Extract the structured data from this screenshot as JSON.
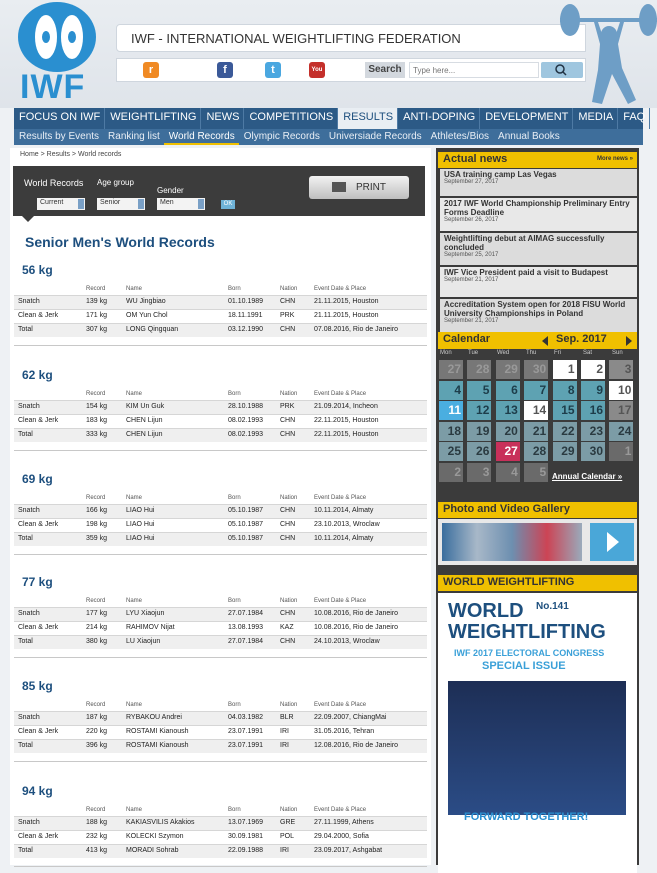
{
  "site": {
    "logo": "IWF",
    "title": "IWF  -  INTERNATIONAL WEIGHTLIFTING FEDERATION",
    "search_label": "Search",
    "search_placeholder": "Type here..."
  },
  "nav": [
    "FOCUS ON IWF",
    "WEIGHTLIFTING",
    "NEWS",
    "COMPETITIONS",
    "RESULTS",
    "ANTI-DOPING",
    "DEVELOPMENT",
    "MEDIA",
    "FAQ"
  ],
  "subnav": [
    "Results by Events",
    "Ranking list",
    "World Records",
    "Olympic Records",
    "Universiade Records",
    "Athletes/Bios",
    "Annual Books"
  ],
  "breadcrumb": "Home > Results > World records",
  "filters": {
    "title": "World Records",
    "age_label": "Age group",
    "gender_label": "Gender",
    "current": "Current",
    "age": "Senior",
    "gender": "Men",
    "ok": "OK",
    "print": "PRINT"
  },
  "page_title": "Senior Men's World Records",
  "columns": [
    "Record",
    "Name",
    "Born",
    "Nation",
    "Event Date & Place"
  ],
  "classes": [
    {
      "name": "56 kg",
      "rows": [
        [
          "Snatch",
          "139 kg",
          "WU Jingbiao",
          "01.10.1989",
          "CHN",
          "21.11.2015, Houston"
        ],
        [
          "Clean & Jerk",
          "171 kg",
          "OM Yun Chol",
          "18.11.1991",
          "PRK",
          "21.11.2015, Houston"
        ],
        [
          "Total",
          "307 kg",
          "LONG Qingquan",
          "03.12.1990",
          "CHN",
          "07.08.2016, Rio de Janeiro"
        ]
      ]
    },
    {
      "name": "62 kg",
      "rows": [
        [
          "Snatch",
          "154 kg",
          "KIM Un Guk",
          "28.10.1988",
          "PRK",
          "21.09.2014, Incheon"
        ],
        [
          "Clean & Jerk",
          "183 kg",
          "CHEN Lijun",
          "08.02.1993",
          "CHN",
          "22.11.2015, Houston"
        ],
        [
          "Total",
          "333 kg",
          "CHEN Lijun",
          "08.02.1993",
          "CHN",
          "22.11.2015, Houston"
        ]
      ]
    },
    {
      "name": "69 kg",
      "rows": [
        [
          "Snatch",
          "166 kg",
          "LIAO Hui",
          "05.10.1987",
          "CHN",
          "10.11.2014, Almaty"
        ],
        [
          "Clean & Jerk",
          "198 kg",
          "LIAO Hui",
          "05.10.1987",
          "CHN",
          "23.10.2013, Wroclaw"
        ],
        [
          "Total",
          "359 kg",
          "LIAO Hui",
          "05.10.1987",
          "CHN",
          "10.11.2014, Almaty"
        ]
      ]
    },
    {
      "name": "77 kg",
      "rows": [
        [
          "Snatch",
          "177 kg",
          "LYU Xiaojun",
          "27.07.1984",
          "CHN",
          "10.08.2016, Rio de Janeiro"
        ],
        [
          "Clean & Jerk",
          "214 kg",
          "RAHIMOV Nijat",
          "13.08.1993",
          "KAZ",
          "10.08.2016, Rio de Janeiro"
        ],
        [
          "Total",
          "380 kg",
          "LU Xiaojun",
          "27.07.1984",
          "CHN",
          "24.10.2013, Wroclaw"
        ]
      ]
    },
    {
      "name": "85 kg",
      "rows": [
        [
          "Snatch",
          "187 kg",
          "RYBAKOU Andrei",
          "04.03.1982",
          "BLR",
          "22.09.2007, ChiangMai"
        ],
        [
          "Clean & Jerk",
          "220 kg",
          "ROSTAMI Kianoush",
          "23.07.1991",
          "IRI",
          "31.05.2016, Tehran"
        ],
        [
          "Total",
          "396 kg",
          "ROSTAMI Kianoush",
          "23.07.1991",
          "IRI",
          "12.08.2016, Rio de Janeiro"
        ]
      ]
    },
    {
      "name": "94 kg",
      "rows": [
        [
          "Snatch",
          "188 kg",
          "KAKIASVILIS Akakios",
          "13.07.1969",
          "GRE",
          "27.11.1999, Athens"
        ],
        [
          "Clean & Jerk",
          "232 kg",
          "KOLECKI Szymon",
          "30.09.1981",
          "POL",
          "29.04.2000, Sofia"
        ],
        [
          "Total",
          "413 kg",
          "MORADI Sohrab",
          "22.09.1988",
          "IRI",
          "23.09.2017, Ashgabat"
        ]
      ]
    }
  ],
  "news": {
    "title": "Actual news",
    "more": "More news »",
    "items": [
      {
        "title": "USA training camp Las Vegas",
        "date": "September 27, 2017"
      },
      {
        "title": "2017 IWF World Championship Preliminary Entry Forms Deadline",
        "date": "September 26, 2017"
      },
      {
        "title": "Weightlifting debut at AIMAG successfully concluded",
        "date": "September 25, 2017"
      },
      {
        "title": "IWF Vice President paid a visit to Budapest",
        "date": "September 21, 2017"
      },
      {
        "title": "Accreditation System open for 2018 FISU World University Championships in Poland",
        "date": "September 21, 2017"
      }
    ]
  },
  "calendar": {
    "title": "Calendar",
    "month": "Sep. 2017",
    "dows": [
      "Mon",
      "Tue",
      "Wed",
      "Thu",
      "Fri",
      "Sat",
      "Sun"
    ],
    "annual": "Annual Calendar »",
    "days": [
      [
        "27",
        "28",
        "29",
        "30",
        "1",
        "2",
        "3"
      ],
      [
        "4",
        "5",
        "6",
        "7",
        "8",
        "9",
        "10"
      ],
      [
        "11",
        "12",
        "13",
        "14",
        "15",
        "16",
        "17"
      ],
      [
        "18",
        "19",
        "20",
        "21",
        "22",
        "23",
        "24"
      ],
      [
        "25",
        "26",
        "27",
        "28",
        "29",
        "30",
        "1"
      ],
      [
        "2",
        "3",
        "4",
        "5",
        "",
        "",
        ""
      ]
    ]
  },
  "gallery": {
    "title": "Photo and Video Gallery"
  },
  "magazine": {
    "title": "WORLD WEIGHTLIFTING",
    "name": "WORLD WEIGHTLIFTING",
    "issue": "No.141",
    "sub1": "IWF 2017 ELECTORAL CONGRESS",
    "sub2": "SPECIAL ISSUE",
    "tagline": "FORWARD TOGETHER!"
  },
  "colors": {
    "nav": "#2c5a86",
    "accent": "#f0c000",
    "brand": "#2a8fd0"
  }
}
